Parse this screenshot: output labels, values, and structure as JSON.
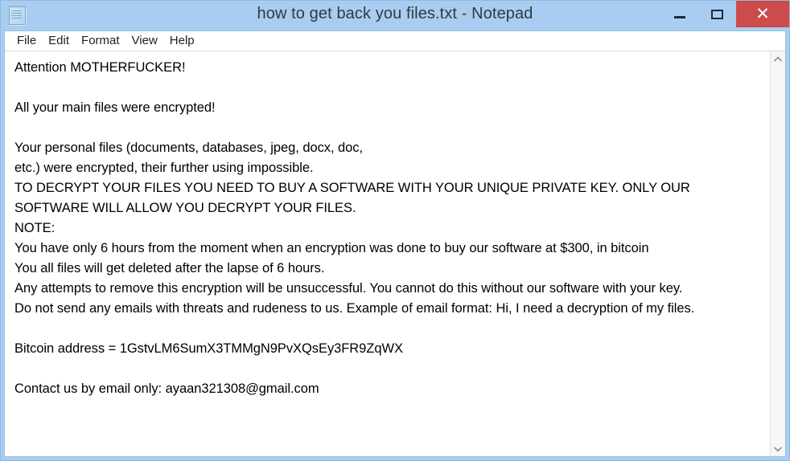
{
  "window": {
    "title": "how to get back you files.txt - Notepad",
    "icon": "notepad-icon",
    "titlebar_color": "#a8cdf0",
    "close_button_color": "#cc4b4b",
    "controls": {
      "minimize_label": "—",
      "maximize_label": "☐",
      "close_label": "✕"
    }
  },
  "menu": {
    "items": [
      {
        "label": "File"
      },
      {
        "label": "Edit"
      },
      {
        "label": "Format"
      },
      {
        "label": "View"
      },
      {
        "label": "Help"
      }
    ]
  },
  "document": {
    "lines": [
      "Attention MOTHERFUCKER!",
      "",
      "All your main files were encrypted!",
      "",
      "Your personal files (documents, databases, jpeg, docx, doc,",
      "etc.) were encrypted, their further using impossible.",
      "TO DECRYPT YOUR FILES YOU NEED TO BUY A SOFTWARE WITH YOUR UNIQUE PRIVATE KEY. ONLY OUR",
      "SOFTWARE WILL ALLOW YOU DECRYPT YOUR FILES.",
      "NOTE:",
      "You have only 6 hours from the moment when an encryption was done to buy our software at $300, in bitcoin",
      "You all files will get deleted after the lapse of 6 hours.",
      "Any attempts to remove this encryption will be unsuccessful. You cannot do this without our software with your key.",
      "Do not send any emails with threats and rudeness to us. Example of email format: Hi, I need a decryption of my files.",
      "",
      "Bitcoin address = 1GstvLM6SumX3TMMgN9PvXQsEy3FR9ZqWX",
      "",
      "Contact us by email only: ayaan321308@gmail.com"
    ],
    "ransom_amount": "$300",
    "deadline_hours": "6 hours",
    "bitcoin_address": "1GstvLM6SumX3TMMgN9PvXQsEy3FR9ZqWX",
    "contact_email": "ayaan321308@gmail.com"
  },
  "scrollbar": {
    "up_arrow": "chevron-up-icon",
    "down_arrow": "chevron-down-icon"
  }
}
